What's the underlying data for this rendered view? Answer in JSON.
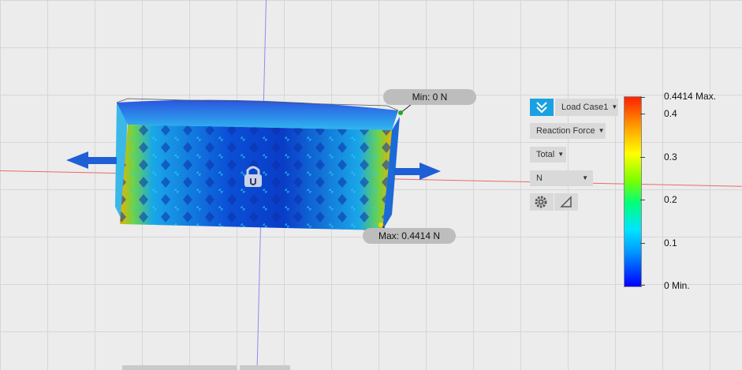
{
  "callouts": {
    "min_label": "Min: 0 N",
    "max_label": "Max: 0.4414 N"
  },
  "panel": {
    "load_case": "Load Case1",
    "result_type": "Reaction Force",
    "component": "Total",
    "unit": "N"
  },
  "legend": {
    "max_label": "0.4414 Max.",
    "ticks": [
      "0.4",
      "0.3",
      "0.2",
      "0.1"
    ],
    "min_label": "0 Min."
  },
  "icons": {
    "collapse": "double-chevron-down-icon",
    "settings": "gear-icon",
    "probe": "triangle-ruler-icon",
    "constraint": "padlock-icon",
    "load_arrows": "arrow-icon"
  },
  "colors": {
    "accent": "#1ba1e2",
    "arrow": "#1e5fd6",
    "body_low": "#0a3cc8",
    "body_high": "#ff2000"
  }
}
